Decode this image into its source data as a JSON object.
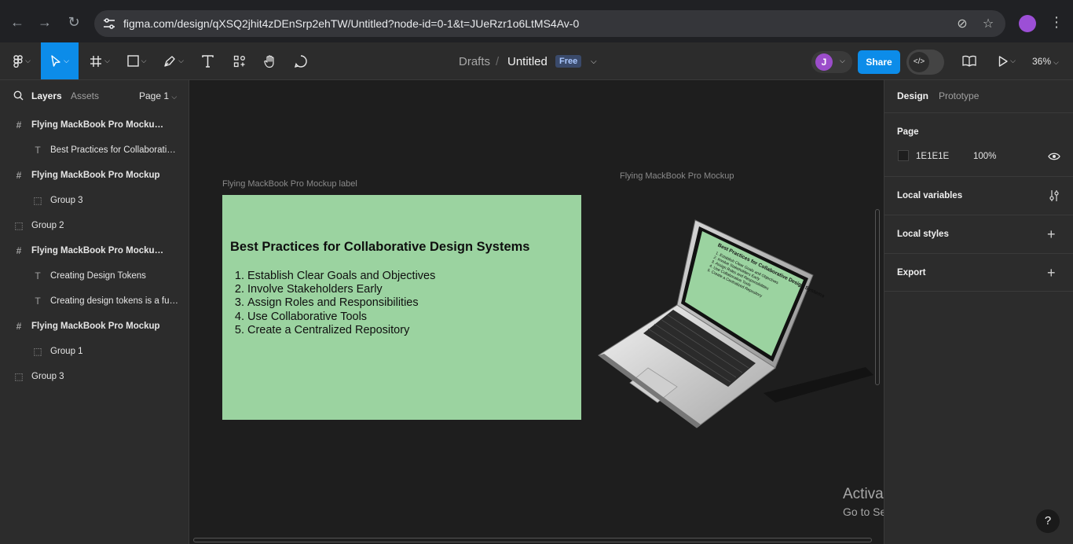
{
  "browser": {
    "url": "figma.com/design/qXSQ2jhit4zDEnSrp2ehTW/Untitled?node-id=0-1&t=JUeRzr1o6LtMS4Av-0"
  },
  "toolbar": {
    "breadcrumb_drafts": "Drafts",
    "breadcrumb_sep": "/",
    "file_title": "Untitled",
    "plan_badge": "Free",
    "avatar_initial": "J",
    "share_label": "Share",
    "zoom": "36%"
  },
  "left_panel": {
    "tab_layers": "Layers",
    "tab_assets": "Assets",
    "page_selector": "Page 1",
    "layers": [
      {
        "name": "Flying MackBook Pro Mockup label"
      },
      {
        "name": "Best Practices for Collaborative Design Systems"
      },
      {
        "name": "Flying MackBook Pro Mockup"
      },
      {
        "name": "Group 3"
      },
      {
        "name": "Group 2"
      },
      {
        "name": "Flying MackBook Pro Mockup label"
      },
      {
        "name": "Creating Design Tokens"
      },
      {
        "name": "Creating design tokens is a fundamental step"
      },
      {
        "name": "Flying MackBook Pro Mockup"
      },
      {
        "name": "Group 1"
      },
      {
        "name": "Group 3"
      }
    ]
  },
  "canvas": {
    "frame1_label": "Flying MackBook Pro Mockup label",
    "frame2_label": "Flying MackBook Pro Mockup",
    "slide_heading": "Best Practices for Collaborative Design Systems",
    "slide_items": [
      "Establish Clear Goals and Objectives",
      "Involve Stakeholders Early",
      "Assign Roles and Responsibilities",
      "Use Collaborative Tools",
      "Create a Centralized Repository"
    ],
    "mini_heading": "Best Practices for Collaborative Design Systems",
    "mini_items": [
      "1. Establish Clear Goals and Objectives",
      "2. Involve Stakeholders Early",
      "3. Assign Roles and Responsibilities",
      "4. Use Collaborative Tools",
      "5. Create a Centralized Repository"
    ],
    "slide_color": "#9bd3a0"
  },
  "watermark": {
    "line1": "Activate Windows",
    "line2": "Go to Settings to activate Windows."
  },
  "right_panel": {
    "tab_design": "Design",
    "tab_prototype": "Prototype",
    "page_section": "Page",
    "page_color": "1E1E1E",
    "page_opacity": "100%",
    "local_variables": "Local variables",
    "local_styles": "Local styles",
    "export": "Export"
  },
  "help_label": "?"
}
